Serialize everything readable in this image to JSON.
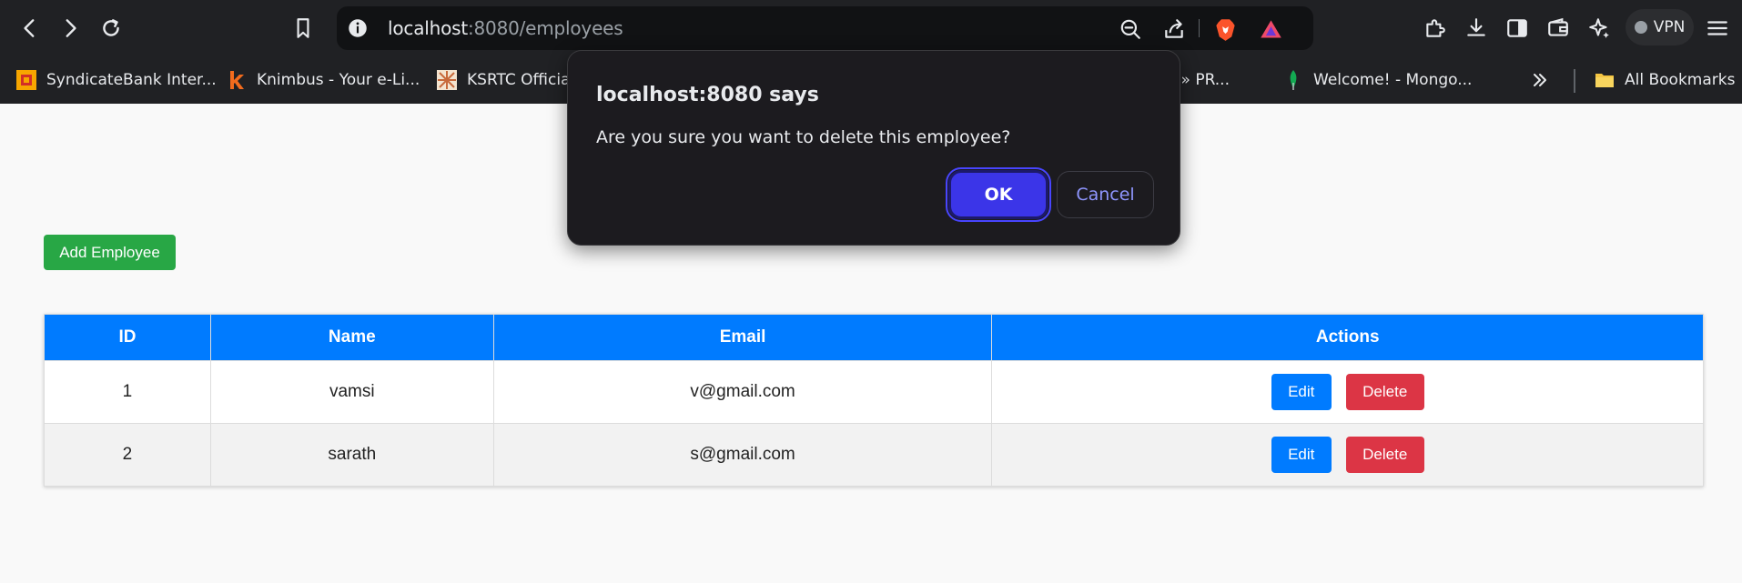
{
  "browser": {
    "url_host": "localhost",
    "url_path": ":8080/employees",
    "vpn_label": "VPN",
    "bookmarks": [
      {
        "label": "SyndicateBank Inter...",
        "icon": "syndicatebank-icon"
      },
      {
        "label": "Knimbus - Your e-Li...",
        "icon": "knimbus-icon"
      },
      {
        "label": "KSRTC Official",
        "icon": "ksrtc-icon"
      },
      {
        "label": "des » PR...",
        "icon": ""
      },
      {
        "label": "Welcome! - Mongo...",
        "icon": "mongodb-leaf-icon"
      }
    ],
    "all_bookmarks_label": "All Bookmarks"
  },
  "dialog": {
    "title": "localhost:8080 says",
    "message": "Are you sure you want to delete this employee?",
    "ok_label": "OK",
    "cancel_label": "Cancel"
  },
  "page": {
    "add_button_label": "Add Employee",
    "table": {
      "headers": [
        "ID",
        "Name",
        "Email",
        "Actions"
      ],
      "rows": [
        {
          "id": "1",
          "name": "vamsi",
          "email": "v@gmail.com",
          "edit_label": "Edit",
          "delete_label": "Delete"
        },
        {
          "id": "2",
          "name": "sarath",
          "email": "s@gmail.com",
          "edit_label": "Edit",
          "delete_label": "Delete"
        }
      ]
    }
  },
  "colors": {
    "header_blue": "#007bff",
    "add_green": "#28a745",
    "delete_red": "#dc3545",
    "ok_purple": "#3b35e8"
  }
}
